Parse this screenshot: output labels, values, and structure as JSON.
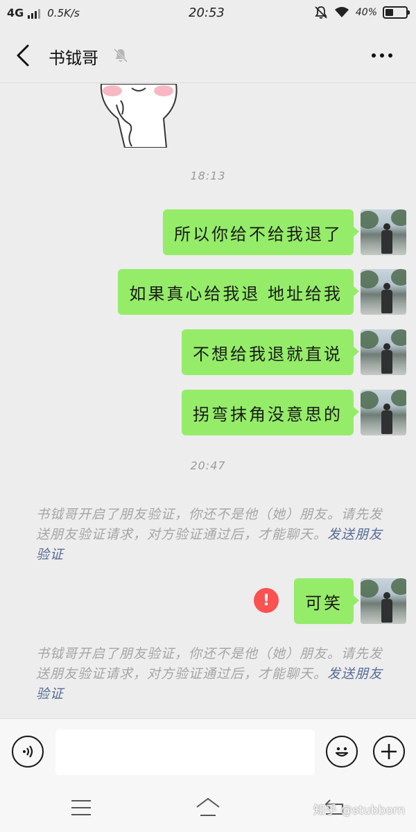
{
  "status_bar": {
    "network": "4G",
    "speed": "0.5K/s",
    "time": "20:53",
    "battery_pct": "40%",
    "battery_level": 0.4,
    "icons": [
      "signal-icon",
      "mute-icon",
      "wifi-icon",
      "battery-icon"
    ]
  },
  "header": {
    "title": "书钺哥",
    "icons": [
      "back-icon",
      "mute-bell-icon",
      "more-icon"
    ]
  },
  "chat": {
    "timestamps": [
      "18:13",
      "20:47"
    ],
    "messages": [
      {
        "text": "所以你给不给我退了",
        "sender": "me"
      },
      {
        "text": "如果真心给我退  地址给我",
        "sender": "me"
      },
      {
        "text": "不想给我退就直说",
        "sender": "me"
      },
      {
        "text": "拐弯抹角没意思的",
        "sender": "me"
      },
      {
        "text": "可笑",
        "sender": "me",
        "failed": true
      }
    ],
    "system_notice": {
      "text": "书钺哥开启了朋友验证，你还不是他（她）朋友。请先发送朋友验证请求，对方验证通过后，才能聊天。",
      "link": "发送朋友验证"
    }
  },
  "input_bar": {
    "icons": [
      "voice-icon",
      "emoji-icon",
      "plus-icon"
    ],
    "value": ""
  },
  "nav_bar": {
    "icons": [
      "menu-icon",
      "home-icon",
      "back-arrow-icon"
    ],
    "watermark": "知乎 @stubborn"
  },
  "colors": {
    "bubble": "#95ec69",
    "background": "#ededed",
    "link": "#576b95",
    "error": "#fa5151"
  }
}
